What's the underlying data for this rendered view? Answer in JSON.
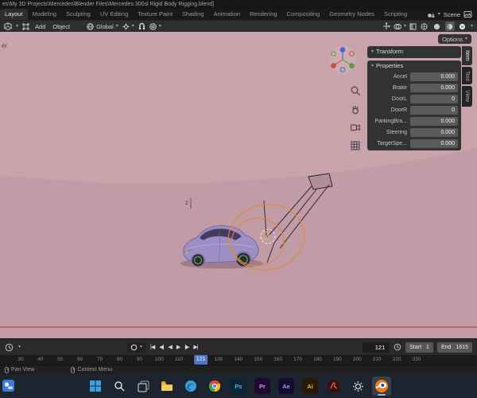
{
  "colors": {
    "accent_blue": "#4f78c4",
    "rig_orange": "#e08a3c",
    "viewport_pink": "#c8a3ac",
    "header_dark": "#2e2e2e"
  },
  "glyphs": {
    "chevron_down": "▾"
  },
  "window": {
    "title": "es\\My 3D Projects\\Mercedes\\Blender Files\\Mercedes 300sl Rigid Body Rigging.blend]"
  },
  "topbar": {
    "tabs": [
      "Layout",
      "Modeling",
      "Sculpting",
      "UV Editing",
      "Texture Paint",
      "Shading",
      "Animation",
      "Rendering",
      "Compositing",
      "Geometry Nodes",
      "Scripting"
    ],
    "active_tab": "Layout",
    "scene_label": "Scene"
  },
  "toolbar": {
    "add_menu": "Add",
    "object_menu": "Object",
    "orientation": "Global",
    "options_label": "Options"
  },
  "viewport": {
    "overlay_text": "er",
    "axis_label": "z",
    "sidebar_tabs": [
      "Item",
      "Tool",
      "View"
    ],
    "active_sidebar_tab": "Item",
    "transform_panel_title": "Transform",
    "properties_panel_title": "Properties",
    "property_rows": [
      {
        "label": "Accel",
        "value": "0.000"
      },
      {
        "label": "Brake",
        "value": "0.000"
      },
      {
        "label": "DoorL",
        "value": "0"
      },
      {
        "label": "DoorR",
        "value": "0"
      },
      {
        "label": "ParkingBra...",
        "value": "0.000"
      },
      {
        "label": "Steering",
        "value": "0.000"
      },
      {
        "label": "TargetSpe...",
        "value": "0.000"
      }
    ]
  },
  "timeline": {
    "playback": [
      {
        "name": "jump-to-start",
        "glyph": "|◀"
      },
      {
        "name": "previous-keyframe",
        "glyph": "◀|"
      },
      {
        "name": "play-reverse",
        "glyph": "◀"
      },
      {
        "name": "play",
        "glyph": "▶"
      },
      {
        "name": "next-keyframe",
        "glyph": "|▶"
      },
      {
        "name": "jump-to-end",
        "glyph": "▶|"
      }
    ],
    "current_frame": "121",
    "playhead_frame": 121,
    "start_label": "Start",
    "start_value": "1",
    "end_label": "End",
    "end_value": "1615",
    "ruler_start_frame": 30,
    "ruler_ticks": [
      30,
      40,
      50,
      60,
      70,
      80,
      90,
      100,
      110,
      130,
      140,
      150,
      160,
      170,
      180,
      190,
      200,
      210,
      220,
      230
    ]
  },
  "statusbar": {
    "items": [
      {
        "label": "Pan View"
      },
      {
        "label": "Context Menu"
      }
    ]
  },
  "taskbar": {
    "adobe_glyphs": {
      "photoshop": "Ps",
      "premiere": "Pr",
      "aftereffects": "Ae",
      "illustrator": "Ai"
    }
  }
}
